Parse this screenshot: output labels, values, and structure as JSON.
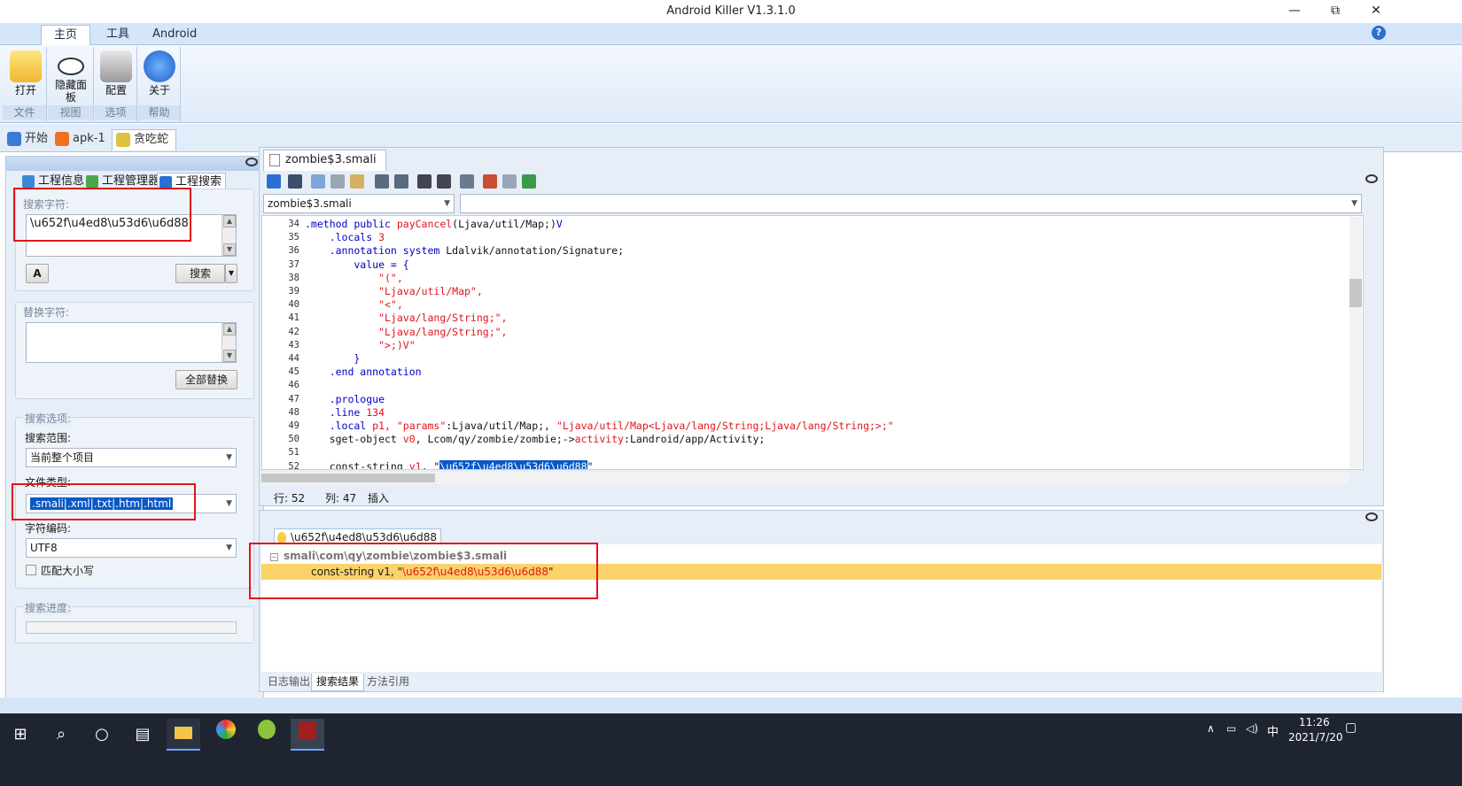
{
  "window": {
    "title": "Android Killer V1.3.1.0",
    "minimize": "—",
    "restore": "⧉",
    "close": "✕"
  },
  "ribbon": {
    "tabs": [
      "主页",
      "工具",
      "Android"
    ],
    "help_icon": "?",
    "buttons": [
      {
        "label": "打开",
        "group": "文件",
        "icon": "folder-icon"
      },
      {
        "label": "隐藏面板",
        "group": "视图",
        "icon": "eye-icon"
      },
      {
        "label": "配置",
        "group": "选项",
        "icon": "tools-icon"
      },
      {
        "label": "关于",
        "group": "帮助",
        "icon": "help-icon"
      }
    ]
  },
  "doc_tabs": [
    {
      "label": "开始",
      "icon": "home-icon"
    },
    {
      "label": "apk-1",
      "icon": "apk-icon"
    },
    {
      "label": "贪吃蛇",
      "icon": "app-icon"
    }
  ],
  "left": {
    "tabs": [
      "工程信息",
      "工程管理器",
      "工程搜索"
    ],
    "search": {
      "label": "搜索字符:",
      "value": "\\u652f\\u4ed8\\u53d6\\u6d88",
      "button": "搜索"
    },
    "replace": {
      "label": "替换字符:",
      "value": "",
      "button": "全部替换"
    },
    "options": {
      "label": "搜索选项:",
      "scope_label": "搜索范围:",
      "scope_value": "当前整个项目",
      "filetype_label": "文件类型:",
      "filetype_value": ".smali|.xml|.txt|.htm|.html",
      "encoding_label": "字符编码:",
      "encoding_value": "UTF8",
      "match_case": "匹配大小写"
    },
    "progress_label": "搜索进度:"
  },
  "editor": {
    "tab": "zombie$3.smali",
    "file_combo": "zombie$3.smali",
    "status": {
      "row": "行: 52",
      "col": "列: 47",
      "mode": "插入"
    }
  },
  "code": [
    {
      "n": "34",
      "parts": [
        [
          ".method public ",
          "kw"
        ],
        [
          "payCancel",
          "st"
        ],
        [
          "(Ljava/util/Map;)",
          "cm"
        ],
        [
          "V",
          "kw"
        ]
      ]
    },
    {
      "n": "35",
      "parts": [
        [
          "    .locals ",
          "kw"
        ],
        [
          "3",
          "st"
        ]
      ]
    },
    {
      "n": "36",
      "parts": [
        [
          "    .annotation system ",
          "kw"
        ],
        [
          "Ldalvik/annotation/Signature;",
          "cm"
        ]
      ]
    },
    {
      "n": "37",
      "parts": [
        [
          "        value = {",
          "kw"
        ]
      ]
    },
    {
      "n": "38",
      "parts": [
        [
          "            \"(\",",
          "st"
        ]
      ]
    },
    {
      "n": "39",
      "parts": [
        [
          "            \"Ljava/util/Map\",",
          "st"
        ]
      ]
    },
    {
      "n": "40",
      "parts": [
        [
          "            \"<\",",
          "st"
        ]
      ]
    },
    {
      "n": "41",
      "parts": [
        [
          "            \"Ljava/lang/String;\",",
          "st"
        ]
      ]
    },
    {
      "n": "42",
      "parts": [
        [
          "            \"Ljava/lang/String;\",",
          "st"
        ]
      ]
    },
    {
      "n": "43",
      "parts": [
        [
          "            \">;)V\"",
          "st"
        ]
      ]
    },
    {
      "n": "44",
      "parts": [
        [
          "        }",
          "kw"
        ]
      ]
    },
    {
      "n": "45",
      "parts": [
        [
          "    .end annotation",
          "kw"
        ]
      ]
    },
    {
      "n": "46",
      "parts": [
        [
          "",
          "cm"
        ]
      ]
    },
    {
      "n": "47",
      "parts": [
        [
          "    .prologue",
          "kw"
        ]
      ]
    },
    {
      "n": "48",
      "parts": [
        [
          "    .line ",
          "kw"
        ],
        [
          "134",
          "st"
        ]
      ]
    },
    {
      "n": "49",
      "parts": [
        [
          "    .local ",
          "kw"
        ],
        [
          "p1, ",
          "st"
        ],
        [
          "\"params\"",
          "st"
        ],
        [
          ":Ljava/util/Map;, ",
          "cm"
        ],
        [
          "\"Ljava/util/Map<Ljava/lang/String;Ljava/lang/String;>;\"",
          "st"
        ]
      ]
    },
    {
      "n": "50",
      "parts": [
        [
          "    sget-object ",
          "cm"
        ],
        [
          "v0",
          "st"
        ],
        [
          ", Lcom/qy/zombie/zombie;->",
          "cm"
        ],
        [
          "activity",
          "st"
        ],
        [
          ":Landroid/app/Activity;",
          "cm"
        ]
      ]
    },
    {
      "n": "51",
      "parts": [
        [
          "",
          "cm"
        ]
      ]
    },
    {
      "n": "52",
      "parts": [
        [
          "    const-string ",
          "cm"
        ],
        [
          "v1",
          "st"
        ],
        [
          ", \"",
          "cm"
        ],
        [
          "\\u652f\\u4ed8\\u53d6\\u6d88",
          "sel"
        ],
        [
          "\"",
          "cm"
        ]
      ]
    }
  ],
  "results": {
    "tab": "\\u652f\\u4ed8\\u53d6\\u6d88",
    "file": "smali\\com\\qy\\zombie\\zombie$3.smali",
    "match_prefix": "const-string v1, \"",
    "match_value": "\\u652f\\u4ed8\\u53d6\\u6d88",
    "match_suffix": "\"",
    "bottom_tabs": [
      "日志输出",
      "搜索结果",
      "方法引用"
    ]
  },
  "taskbar": {
    "time": "11:26",
    "date": "2021/7/20",
    "ime": "中"
  }
}
